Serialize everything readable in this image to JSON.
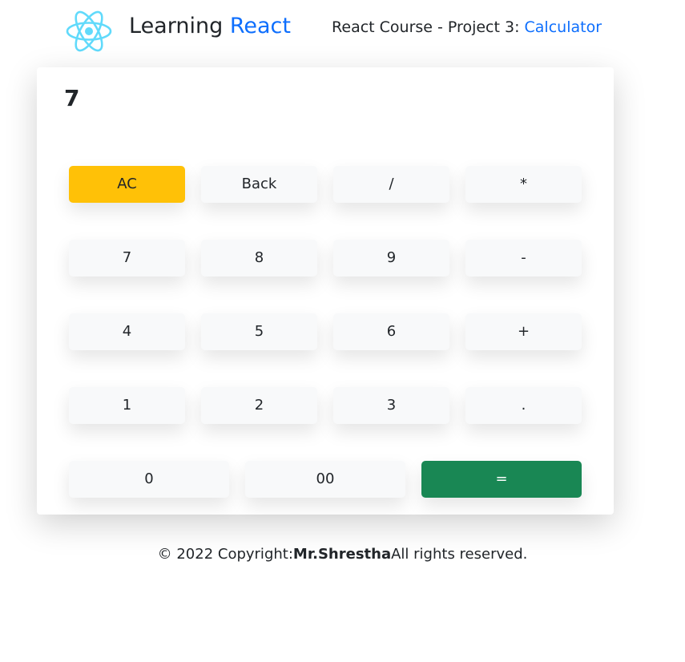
{
  "header": {
    "logo_icon": "react-atom-icon",
    "brand_prefix": "Learning",
    "brand_accent": "React",
    "course_prefix": "React Course - Project 3:",
    "course_link": "Calculator"
  },
  "calculator": {
    "display": "7",
    "rows": [
      [
        {
          "label": "AC"
        },
        {
          "label": "Back"
        },
        {
          "label": "/"
        },
        {
          "label": "*"
        }
      ],
      [
        {
          "label": "7"
        },
        {
          "label": "8"
        },
        {
          "label": "9"
        },
        {
          "label": "-"
        }
      ],
      [
        {
          "label": "4"
        },
        {
          "label": "5"
        },
        {
          "label": "6"
        },
        {
          "label": "+"
        }
      ],
      [
        {
          "label": "1"
        },
        {
          "label": "2"
        },
        {
          "label": "3"
        },
        {
          "label": "."
        }
      ],
      [
        {
          "label": "0"
        },
        {
          "label": "00"
        },
        {
          "label": "="
        }
      ]
    ]
  },
  "footer": {
    "prefix": "© 2022 Copyright:",
    "author": "Mr.Shrestha",
    "suffix": "All rights reserved."
  },
  "colors": {
    "accent": "#0d6efd",
    "clear_button": "#ffc107",
    "equals_button": "#198754",
    "key_background": "#f8f9fa"
  }
}
